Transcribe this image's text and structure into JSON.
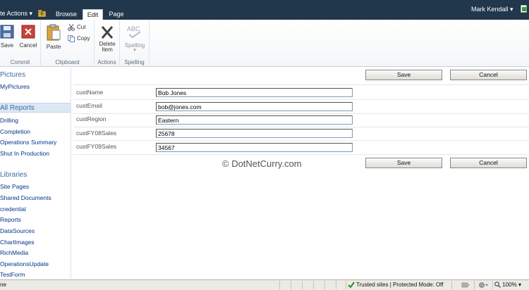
{
  "topbar": {
    "site_actions": "te Actions",
    "site_actions_arrow": "▾",
    "tabs": [
      {
        "label": "Browse"
      },
      {
        "label": "Edit"
      },
      {
        "label": "Page"
      }
    ],
    "user": "Mark Kendall",
    "user_arrow": "▾"
  },
  "ribbon": {
    "commit": {
      "label": "Commit",
      "save": "Save",
      "cancel": "Cancel"
    },
    "clipboard": {
      "label": "Clipboard",
      "paste": "Paste",
      "cut": "Cut",
      "copy": "Copy"
    },
    "actions": {
      "label": "Actions",
      "delete_line1": "Delete",
      "delete_line2": "Item"
    },
    "spelling": {
      "label": "Spelling",
      "spelling": "Spelling",
      "abc": "ABC"
    }
  },
  "leftnav": {
    "pictures_head": "Pictures",
    "pictures_items": [
      "MyPictures"
    ],
    "reports_head": "All Reports",
    "reports_items": [
      "Drilling",
      "Completion",
      "Operations Summary",
      "Shut In Production"
    ],
    "libraries_head": "Libraries",
    "libraries_items": [
      "Site Pages",
      "Shared Documents",
      "credential",
      "Reports",
      "DataSources",
      "ChartImages",
      "RichMedia",
      "OperationsUpdate",
      "TestForm"
    ]
  },
  "form": {
    "save_label": "Save",
    "cancel_label": "Cancel",
    "fields": [
      {
        "label": "custName",
        "value": "Bob Jones"
      },
      {
        "label": "custEmail",
        "value": "bob@jones.com"
      },
      {
        "label": "custRegion",
        "value": "Eastern"
      },
      {
        "label": "custFY08Sales",
        "value": "25678"
      },
      {
        "label": "custFY09Sales",
        "value": "34567"
      }
    ],
    "watermark": "© DotNetCurry.com"
  },
  "statusbar": {
    "left_text": "ne",
    "zone_text": "Trusted sites | Protected Mode: Off",
    "zoom": "100%",
    "zoom_arrow": "▾"
  },
  "colors": {
    "topbar_bg": "#21374c",
    "link": "#00358c",
    "nav_head": "#3b6aa0",
    "nav_selected_bg": "#dde8f5"
  }
}
